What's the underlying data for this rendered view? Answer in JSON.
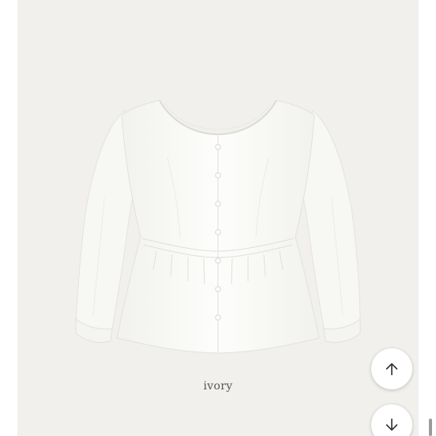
{
  "product": {
    "image_alt": "white blouse",
    "color_label": "ivory"
  },
  "controls": {
    "scroll_up_icon": "arrow-up-icon",
    "scroll_down_icon": "arrow-down-icon"
  },
  "colors": {
    "panel_background": "#f2f0ec",
    "garment": "#fbfbf9",
    "caption_text": "#555555"
  }
}
